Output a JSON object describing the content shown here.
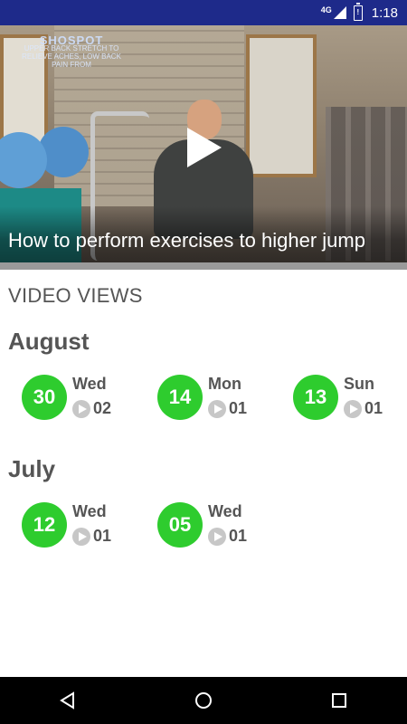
{
  "status_bar": {
    "network": "4G",
    "time": "1:18"
  },
  "video": {
    "title": "How to perform exercises to higher jump",
    "logo_brand": "SHOSPOT",
    "logo_caption": "UPPER BACK STRETCH TO RELIEVE ACHES, LOW BACK PAIN FROM"
  },
  "section_title": "VIDEO VIEWS",
  "months": [
    {
      "name": "August",
      "days": [
        {
          "date": "30",
          "weekday": "Wed",
          "views": "02"
        },
        {
          "date": "14",
          "weekday": "Mon",
          "views": "01"
        },
        {
          "date": "13",
          "weekday": "Sun",
          "views": "01"
        }
      ]
    },
    {
      "name": "July",
      "days": [
        {
          "date": "12",
          "weekday": "Wed",
          "views": "01"
        },
        {
          "date": "05",
          "weekday": "Wed",
          "views": "01"
        }
      ]
    }
  ],
  "colors": {
    "status_bar": "#1e2a8a",
    "date_circle": "#2ecc2e",
    "text": "#555555"
  },
  "icons": {
    "play": "play-icon",
    "view": "play-circle-icon",
    "back": "back-icon",
    "home": "home-icon",
    "recents": "recents-icon"
  }
}
